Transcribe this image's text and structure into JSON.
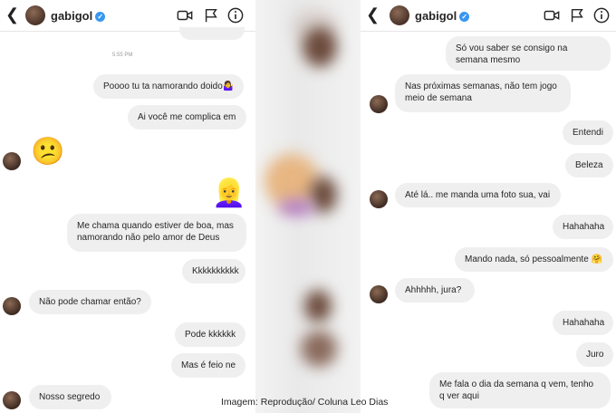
{
  "left": {
    "header": {
      "username": "gabigol"
    },
    "time": "5:55 PM",
    "messages": [
      {
        "text": "Poooo tu ta namorando doido🤷‍♀️"
      },
      {
        "text": "Ai você me complica em"
      },
      {
        "text": "😕"
      },
      {
        "text": "👱‍♀️"
      },
      {
        "text": "Me chama quando estiver de boa, mas namorando não pelo amor de Deus"
      },
      {
        "text": "Kkkkkkkkkk"
      },
      {
        "text": "Não pode chamar então?"
      },
      {
        "text": "Pode kkkkkk"
      },
      {
        "text": "Mas é feio ne"
      },
      {
        "text": "Nosso segredo"
      }
    ]
  },
  "right": {
    "header": {
      "username": "gabigol"
    },
    "messages": [
      {
        "text": "Só vou saber se consigo na semana mesmo"
      },
      {
        "text": "Nas próximas semanas, não tem jogo meio de semana"
      },
      {
        "text": "Entendi"
      },
      {
        "text": "Beleza"
      },
      {
        "text": "Até lá.. me manda uma foto sua, vai"
      },
      {
        "text": "Hahahaha"
      },
      {
        "text": "Mando nada, só pessoalmente 🤗"
      },
      {
        "text": "Ahhhhh, jura?"
      },
      {
        "text": "Hahahaha"
      },
      {
        "text": "Juro"
      },
      {
        "text": "Me fala o dia da semana q vem, tenho q ver aqui"
      }
    ]
  },
  "caption": "Imagem: Reprodução/ Coluna Leo Dias"
}
